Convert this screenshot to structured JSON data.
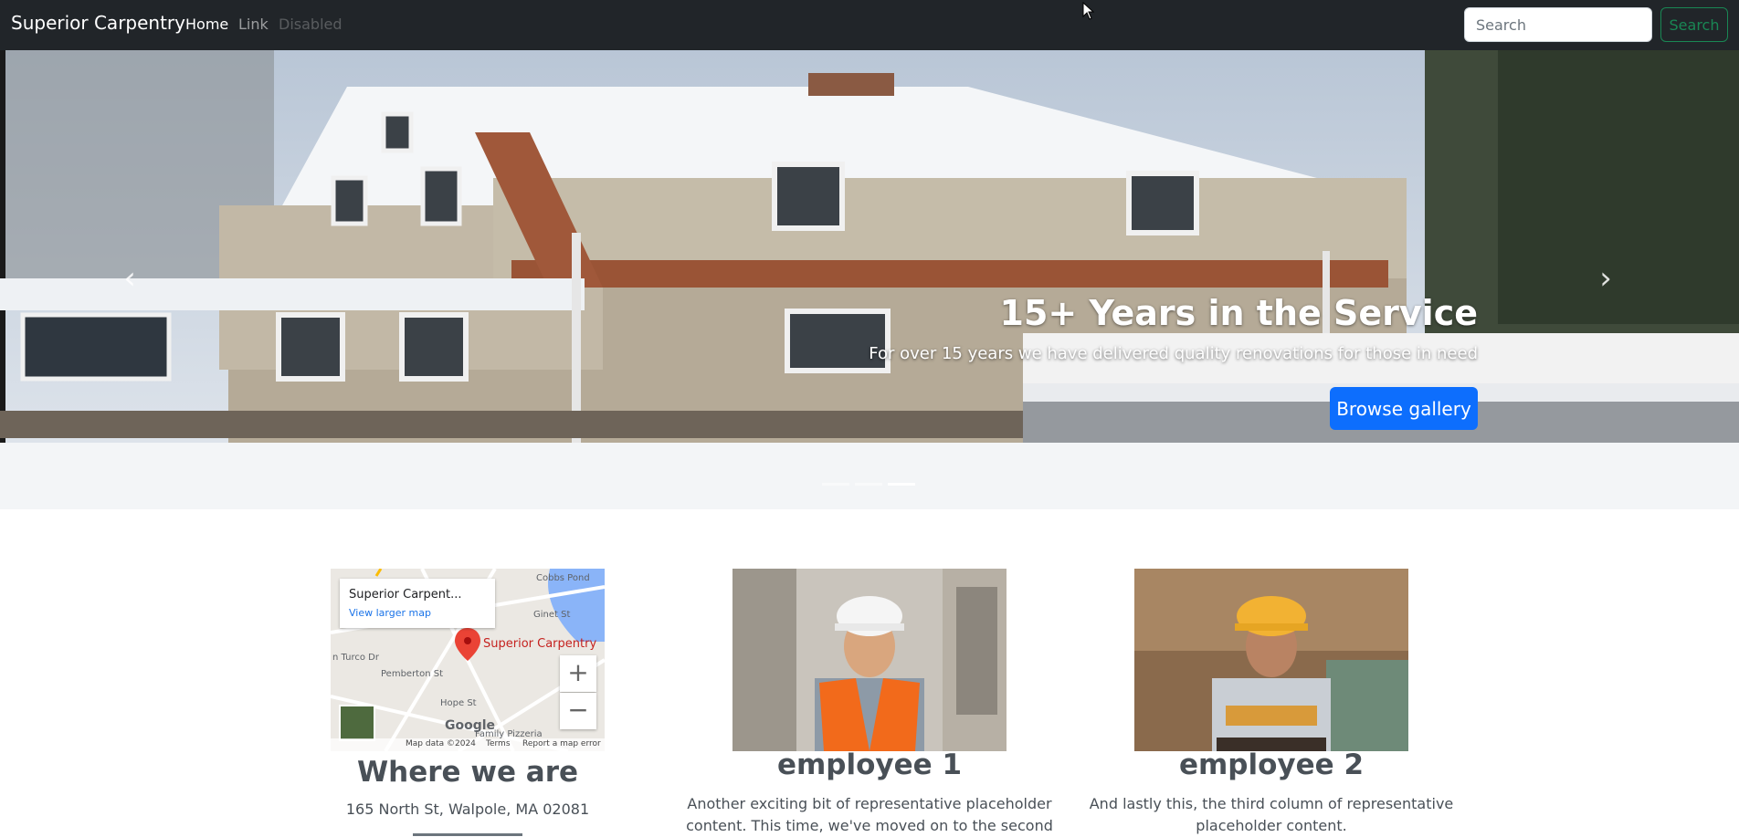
{
  "navbar": {
    "brand": "Superior Carpentry",
    "links": [
      {
        "label": "Home"
      },
      {
        "label": "Link"
      },
      {
        "label": "Disabled"
      }
    ],
    "search_placeholder": "Search",
    "search_button": "Search"
  },
  "hero": {
    "title": "15+ Years in the Service",
    "text": "For over 15 years we have delivered quality renovations for those in need",
    "button": "Browse gallery",
    "prev_icon": "chevron-left-icon",
    "next_icon": "chevron-right-icon",
    "slide_count": 3,
    "active_slide": 3
  },
  "location": {
    "title": "Where we are",
    "address": "165 North St, Walpole, MA 02081",
    "map": {
      "place_name": "Superior Carpent...",
      "larger_map": "View larger map",
      "pin_label": "Superior Carpentry",
      "zoom_in": "+",
      "zoom_out": "−",
      "footer_data": "Map data ©2024",
      "footer_terms": "Terms",
      "footer_report": "Report a map error",
      "logo": "Google",
      "streets": [
        "Pemberton St",
        "Hope St",
        "n Turco Dr",
        "Family Pizzeria",
        "Cobbs Pond",
        "Ginet St"
      ]
    }
  },
  "employees": [
    {
      "name": "employee 1",
      "text": "Another exciting bit of representative placeholder content. This time, we've moved on to the second"
    },
    {
      "name": "employee 2",
      "text": "And lastly this, the third column of representative placeholder content."
    }
  ],
  "colors": {
    "navbar_bg": "#212529",
    "primary": "#0d6efd",
    "success": "#198754"
  }
}
